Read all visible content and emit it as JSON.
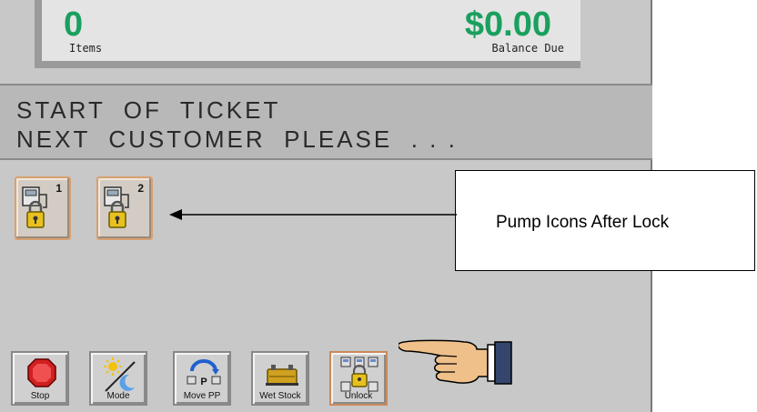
{
  "totals": {
    "items_count": "0",
    "items_label": "Items",
    "balance": "$0.00",
    "balance_label": "Balance Due"
  },
  "message": {
    "line1": "START  OF  TICKET",
    "line2": "NEXT  CUSTOMER  PLEASE  . . ."
  },
  "pumps": [
    {
      "number": "1",
      "icon": "locked-pump-icon"
    },
    {
      "number": "2",
      "icon": "locked-pump-icon"
    }
  ],
  "toolbar": {
    "stop": "Stop",
    "mode": "Mode",
    "move_pp": "Move PP",
    "wet_stock": "Wet Stock",
    "unlock": "Unlock"
  },
  "annotation": {
    "callout_text": "Pump Icons After Lock"
  },
  "colors": {
    "amount_green": "#1aa05e",
    "panel_gray": "#c8c8c8",
    "lock_yellow": "#e8c020"
  }
}
